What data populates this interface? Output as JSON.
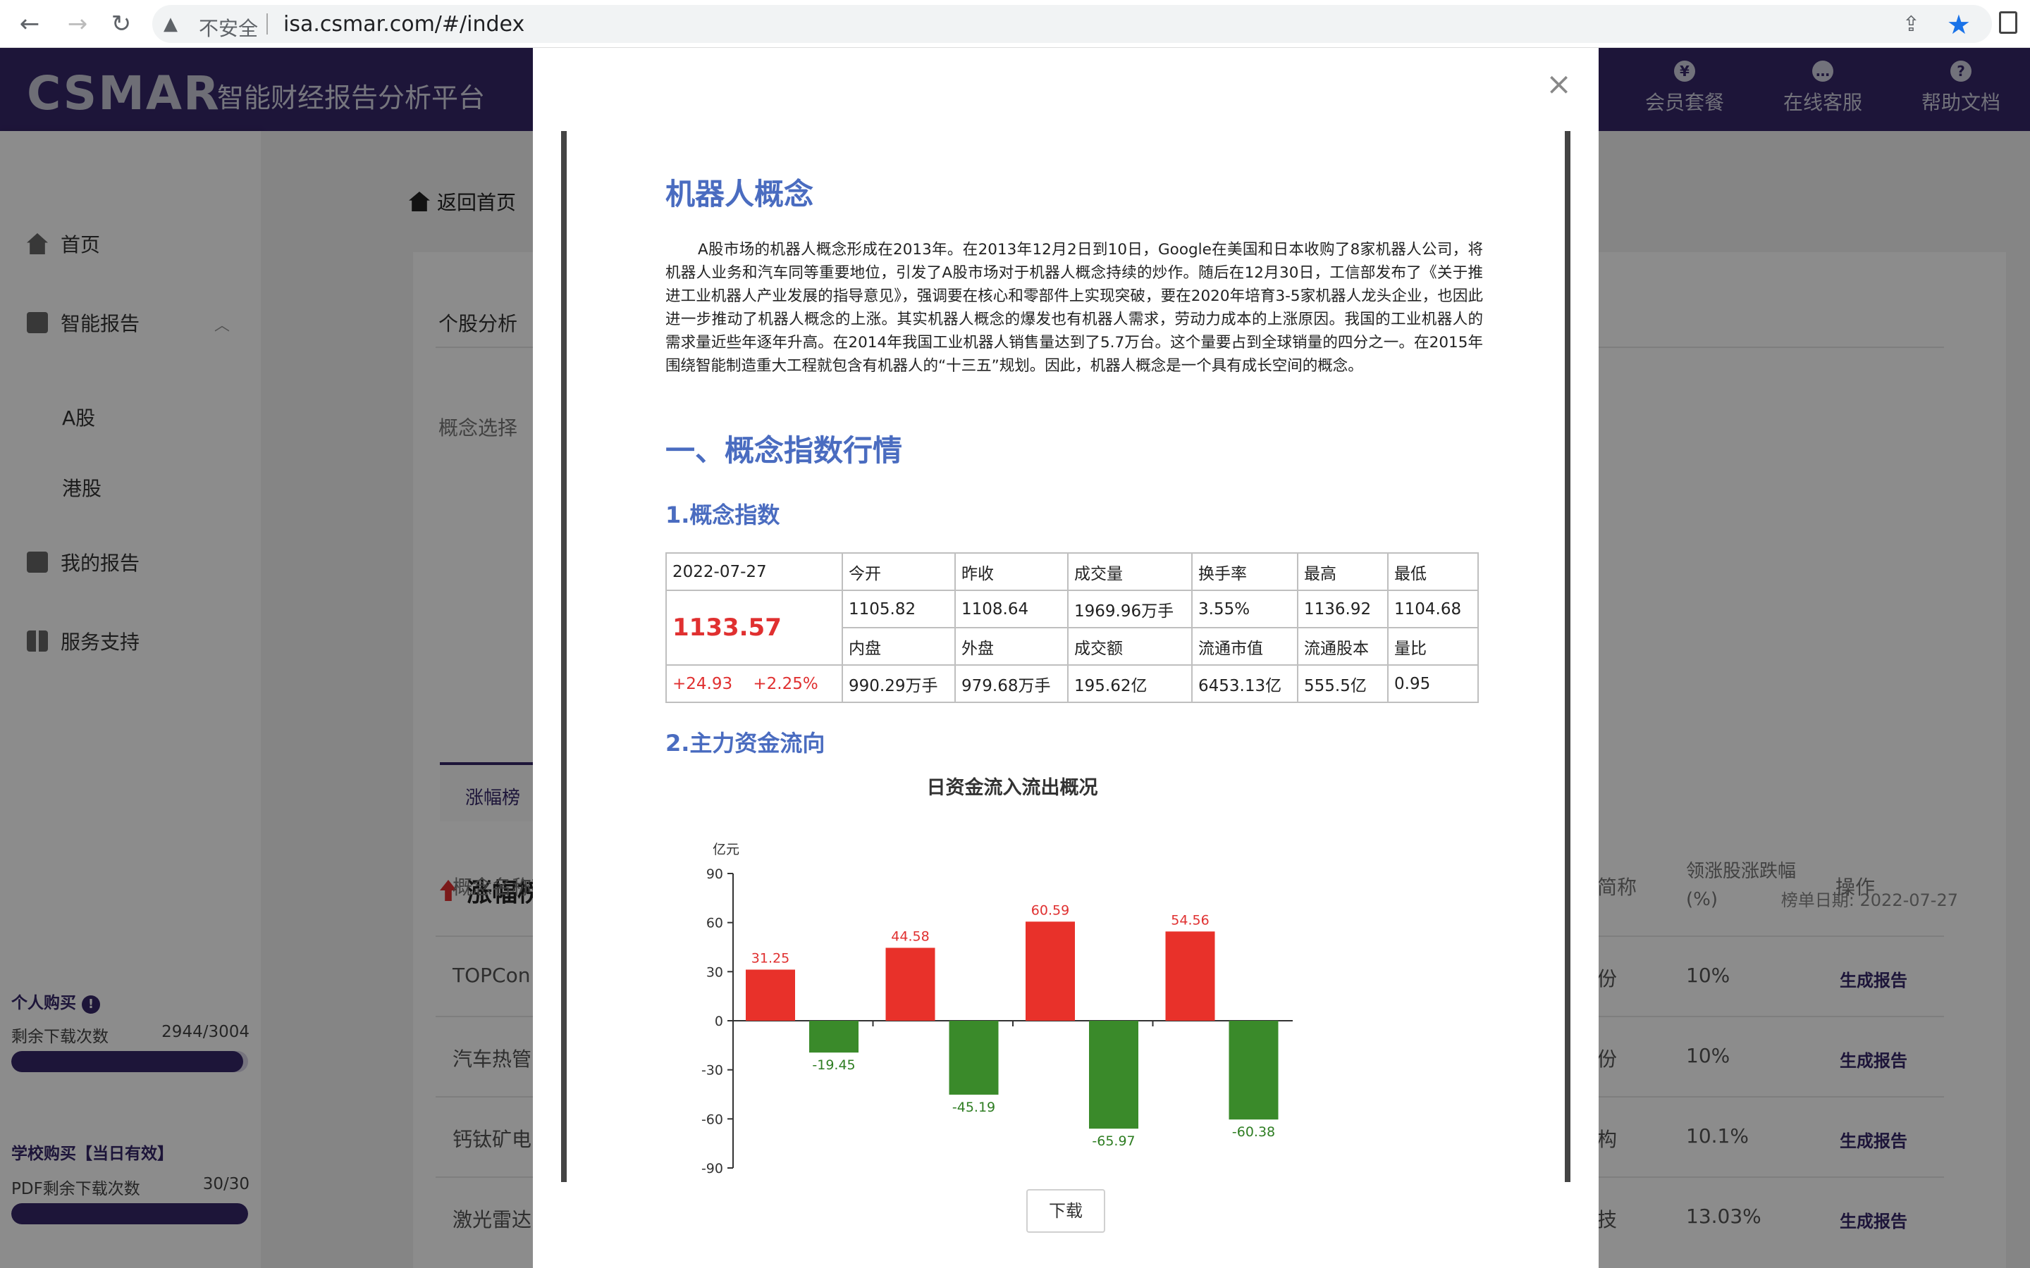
{
  "browser": {
    "security": "不安全",
    "url": "isa.csmar.com/#/index"
  },
  "header": {
    "logo": "CSMAR",
    "subtitle": "智能财经报告分析平台",
    "items": [
      {
        "icon": "¥",
        "label": "会员套餐"
      },
      {
        "icon": "…",
        "label": "在线客服"
      },
      {
        "icon": "?",
        "label": "帮助文档"
      }
    ]
  },
  "sidebar": {
    "home": "首页",
    "smart_report": "智能报告",
    "a_share": "A股",
    "hk_share": "港股",
    "my_report": "我的报告",
    "service": "服务支持",
    "personal_title": "个人购买",
    "personal_label": "剩余下载次数",
    "personal_value": "2944/3004",
    "personal_fraction": 0.98,
    "school_title": "学校购买【当日有效】",
    "school_label": "PDF剩余下载次数",
    "school_value": "30/30",
    "school_fraction": 1.0
  },
  "main": {
    "back_home": "返回首页",
    "stock_analysis": "个股分析",
    "concept_select": "概念选择",
    "tab_active": "涨幅榜",
    "rank_title": "涨幅榜",
    "rank_date": "榜单日期: 2022-07-27",
    "col_name": "概念名称",
    "col_short": "简称",
    "col_leader_pct_1": "领涨股涨跌幅",
    "col_leader_pct_2": "(%)",
    "col_action": "操作",
    "rows": [
      {
        "name": "TOPCon",
        "cut": "份",
        "pct": "10%",
        "action": "生成报告"
      },
      {
        "name": "汽车热管",
        "cut": "份",
        "pct": "10%",
        "action": "生成报告"
      },
      {
        "name": "钙钛矿电",
        "cut": "构",
        "pct": "10.1%",
        "action": "生成报告"
      },
      {
        "name": "激光雷达",
        "cut": "技",
        "pct": "13.03%",
        "action": "生成报告"
      }
    ]
  },
  "modal": {
    "close": "×",
    "title": "机器人概念",
    "intro": "A股市场的机器人概念形成在2013年。在2013年12月2日到10日，Google在美国和日本收购了8家机器人公司，将机器人业务和汽车同等重要地位，引发了A股市场对于机器人概念持续的炒作。随后在12月30日，工信部发布了《关于推进工业机器人产业发展的指导意见》，强调要在核心和零部件上实现突破，要在2020年培育3-5家机器人龙头企业，也因此进一步推动了机器人概念的上涨。其实机器人概念的爆发也有机器人需求，劳动力成本的上涨原因。我国的工业机器人的需求量近些年逐年升高。在2014年我国工业机器人销售量达到了5.7万台。这个量要占到全球销量的四分之一。在2015年围绕智能制造重大工程就包含有机器人的“十三五”规划。因此，机器人概念是一个具有成长空间的概念。",
    "h1": "一、概念指数行情",
    "h2a": "1.概念指数",
    "h2b": "2.主力资金流向",
    "download": "下载",
    "quote": {
      "date": "2022-07-27",
      "price": "1133.57",
      "change": "+24.93",
      "change_pct": "+2.25%",
      "h_open": "今开",
      "v_open": "1105.82",
      "h_prev": "昨收",
      "v_prev": "1108.64",
      "h_vol": "成交量",
      "v_vol": "1969.96万手",
      "h_turn": "换手率",
      "v_turn": "3.55%",
      "h_high": "最高",
      "v_high": "1136.92",
      "h_low": "最低",
      "v_low": "1104.68",
      "h_inner": "内盘",
      "v_inner": "990.29万手",
      "h_outer": "外盘",
      "v_outer": "979.68万手",
      "h_amount": "成交额",
      "v_amount": "195.62亿",
      "h_mcap": "流通市值",
      "v_mcap": "6453.13亿",
      "h_shares": "流通股本",
      "v_shares": "555.5亿",
      "h_ratio": "量比",
      "v_ratio": "0.95"
    }
  },
  "chart_data": {
    "type": "bar",
    "title": "日资金流入流出概况",
    "ylabel": "亿元",
    "ylim": [
      -90,
      90
    ],
    "yticks": [
      90,
      60,
      30,
      0,
      -30,
      -60,
      -90
    ],
    "inflow": [
      31.25,
      44.58,
      60.59,
      54.56
    ],
    "outflow": [
      -19.45,
      -45.19,
      -65.97,
      -60.38
    ],
    "inflow_color": "#e8312a",
    "outflow_color": "#3a8a2a"
  }
}
